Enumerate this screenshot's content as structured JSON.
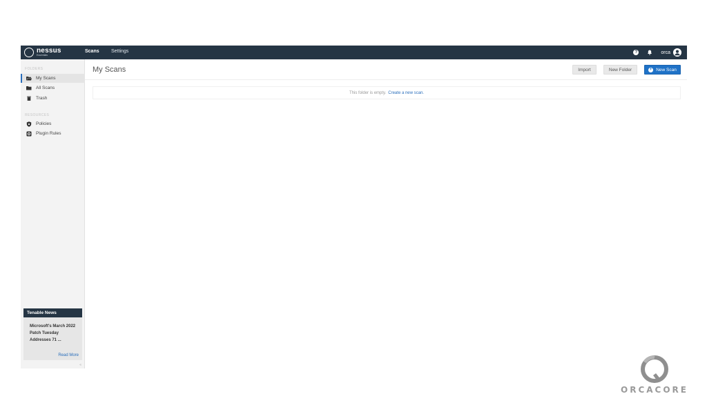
{
  "header": {
    "logo_name": "nessus",
    "logo_sub": "Essentials",
    "nav": {
      "scans": "Scans",
      "settings": "Settings"
    },
    "help_glyph": "?",
    "user_name": "orca"
  },
  "sidebar": {
    "folders_heading": "FOLDERS",
    "folders": [
      {
        "label": "My Scans",
        "icon": "folder-open-icon"
      },
      {
        "label": "All Scans",
        "icon": "folder-icon"
      },
      {
        "label": "Trash",
        "icon": "trash-icon"
      }
    ],
    "resources_heading": "RESOURCES",
    "resources": [
      {
        "label": "Policies",
        "icon": "shield-icon"
      },
      {
        "label": "Plugin Rules",
        "icon": "plugin-icon"
      }
    ],
    "news": {
      "title": "Tenable News",
      "headline": "Microsoft's March 2022 Patch Tuesday Addresses 71 ...",
      "read_more": "Read More"
    },
    "collapse_glyph": "«"
  },
  "main": {
    "title": "My Scans",
    "buttons": {
      "import": "Import",
      "new_folder": "New Folder",
      "new_scan": "New Scan"
    },
    "empty_text": "This folder is empty.",
    "empty_link": "Create a new scan."
  },
  "watermark": {
    "text": "ORCACORE"
  },
  "colors": {
    "topbar": "#253544",
    "accent": "#1f72c7",
    "sidebar": "#f3f3f3"
  }
}
